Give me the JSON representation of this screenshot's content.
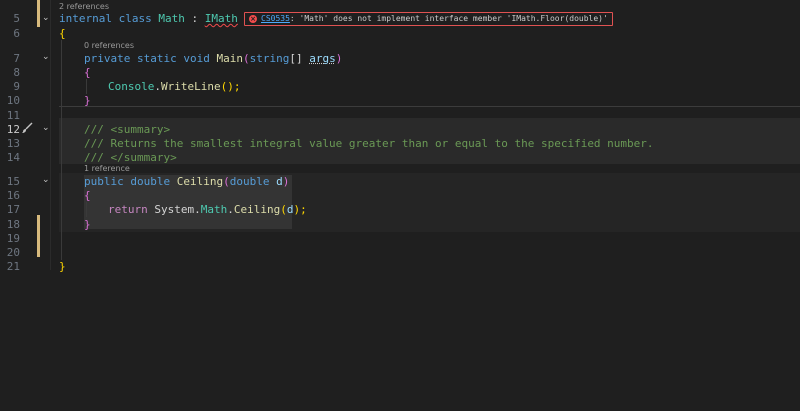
{
  "codelens": {
    "class_refs": "2 references",
    "main_refs": "0 references",
    "ceiling_refs": "1 reference"
  },
  "line_numbers": [
    "5",
    "6",
    "7",
    "8",
    "9",
    "10",
    "11",
    "12",
    "13",
    "14",
    "15",
    "16",
    "17",
    "18",
    "19",
    "20",
    "21"
  ],
  "lines": {
    "l5": {
      "kw1": "internal",
      "kw2": "class",
      "name": "Math",
      "colon": " : ",
      "iface": "IMath"
    },
    "l6": {
      "brace": "{"
    },
    "l7": {
      "kw1": "private",
      "kw2": "static",
      "kw3": "void",
      "fn": "Main",
      "open": "(",
      "type": "string",
      "arr": "[] ",
      "param": "args",
      "close": ")"
    },
    "l8": {
      "brace": "{"
    },
    "l9": {
      "type": "Console",
      "dot": ".",
      "fn": "WriteLine",
      "args": "();"
    },
    "l10": {
      "brace": "}"
    },
    "l12": {
      "text": "/// <summary>"
    },
    "l13": {
      "text": "/// Returns the smallest integral value greater than or equal to the specified number."
    },
    "l14": {
      "text": "/// </summary>"
    },
    "l15": {
      "kw1": "public",
      "kw2": "double",
      "fn": "Ceiling",
      "open": "(",
      "type": "double",
      "param": "d",
      "close": ")"
    },
    "l16": {
      "brace": "{"
    },
    "l17": {
      "kw": "return",
      "ns1": "System",
      "dot1": ".",
      "ns2": "Math",
      "dot2": ".",
      "fn": "Ceiling",
      "open": "(",
      "param": "d",
      "close": ");"
    },
    "l18": {
      "brace": "}"
    },
    "l21": {
      "brace": "}"
    }
  },
  "diagnostic": {
    "code": "CS0535",
    "message": ": 'Math' does not implement interface member 'IMath.Floor(double)'",
    "severity_color": "#f14c4c"
  },
  "icons": {
    "fold": "chevron-down-icon",
    "error": "error-circle-icon",
    "quick_action": "brush-icon"
  }
}
